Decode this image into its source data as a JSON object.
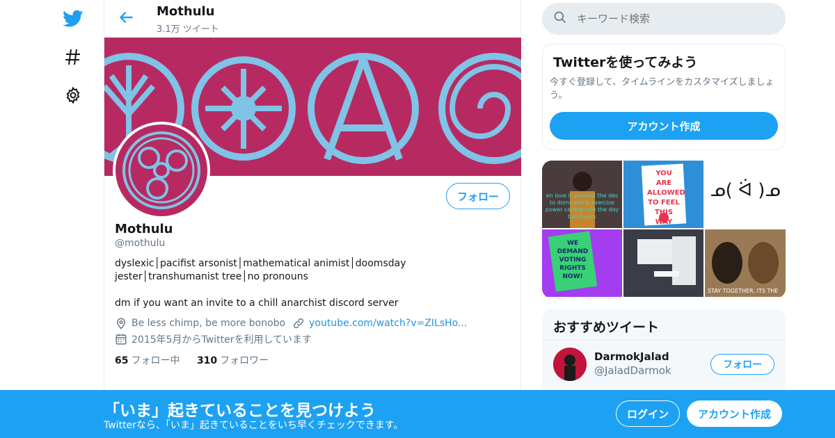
{
  "nav": {
    "items": [
      {
        "icon": "twitter-bird-icon"
      },
      {
        "icon": "hashtag-icon"
      },
      {
        "icon": "gear-icon"
      }
    ]
  },
  "header": {
    "title": "Mothulu",
    "tweet_count": "3.1万 ツイート"
  },
  "profile": {
    "follow_label": "フォロー",
    "name": "Mothulu",
    "handle": "@mothulu",
    "bio_line1": "dyslexic│pacifist arsonist│mathematical animist│doomsday jester│transhumanist tree│no pronouns",
    "bio_line2": "dm if you want an invite to a chill anarchist discord server",
    "location": "Be less chimp, be more bonobo",
    "url": "youtube.com/watch?v=ZILsHo...",
    "joined": "2015年5月からTwitterを利用しています",
    "following_count": "65",
    "following_label": "フォロー中",
    "followers_count": "310",
    "followers_label": "フォロワー",
    "colors": {
      "banner": "#b72a61",
      "symbol": "#7fc3e6"
    }
  },
  "search": {
    "placeholder": "キーワード検索"
  },
  "signup_card": {
    "title": "Twitterを使ってみよう",
    "description": "今すぐ登録して、タイムラインをカスタマイズしましょう。",
    "button": "アカウント作成"
  },
  "media": {
    "captions": [
      "en love is present the des to dominate & exercise power cannot rule the day bell hooks",
      "YOU ARE ALLOWED TO FEEL THIS WAY",
      "ᓄ( ᐛ )ᓄ",
      "WE DEMAND VOTING RIGHTS NOW!",
      "",
      "STAY TOGETHER, ITS THE"
    ]
  },
  "recommended": {
    "title": "おすすめツイート",
    "name": "DarmokJalad",
    "handle": "@JaladDarmok",
    "follow_label": "フォロー"
  },
  "bottombar": {
    "title": "「いま」起きていることを見つけよう",
    "subtitle": "Twitterなら、「いま」起きていることをいち早くチェックできます。",
    "login": "ログイン",
    "signup": "アカウント作成"
  },
  "accent": "#1da1f2"
}
